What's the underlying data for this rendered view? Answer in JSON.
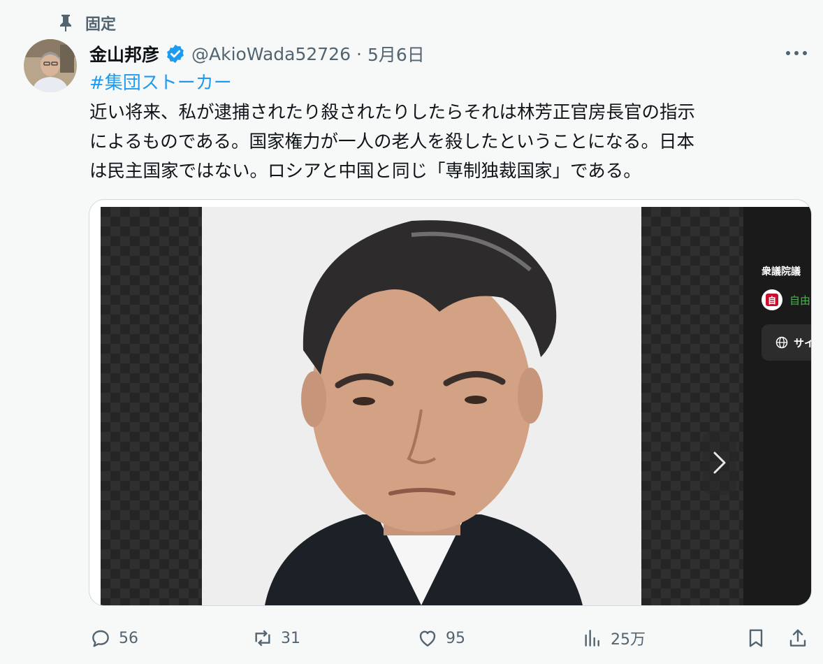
{
  "pinned": {
    "label": "固定"
  },
  "tweet": {
    "author_name": "金山邦彦",
    "handle": "@AkioWada52726",
    "separator": "·",
    "date": "5月6日",
    "hashtag": "#集団ストーカー",
    "body_lines": [
      "近い将来、私が逮捕されたり殺されたりしたらそれは林芳正官房長官の指示",
      "によるものである。国家権力が一人の老人を殺したということになる。日本",
      "は民主国家ではない。ロシアと中国と同じ「専制独裁国家」である。"
    ]
  },
  "media": {
    "side_title": "衆議院議",
    "party_mark": "自",
    "party_name": "自由",
    "site_button": "サイ"
  },
  "actions": {
    "replies": "56",
    "retweets": "31",
    "likes": "95",
    "views": "25万"
  },
  "colors": {
    "accent": "#1d9bf0",
    "muted": "#536471",
    "text": "#0f1419",
    "background": "#f7f9f9"
  }
}
